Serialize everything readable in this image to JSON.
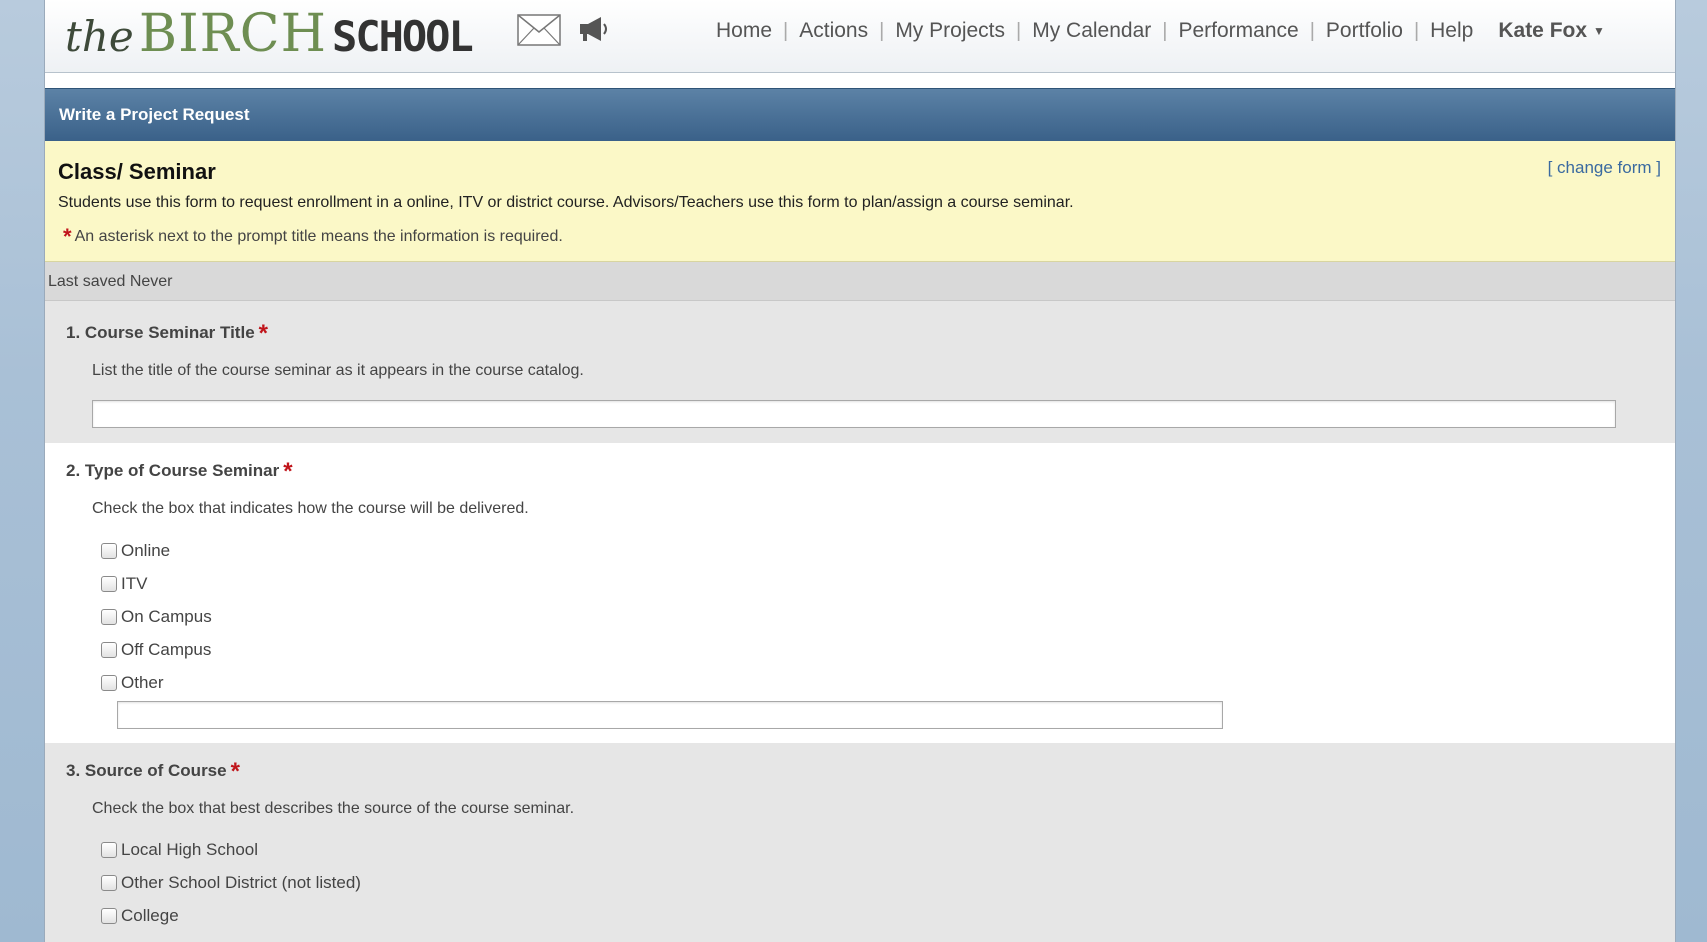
{
  "header": {
    "logo": {
      "the": "the",
      "birch": "BIRCH",
      "school": "SCHOOL"
    },
    "icons": [
      "mail-icon",
      "megaphone-icon"
    ],
    "nav": [
      "Home",
      "Actions",
      "My Projects",
      "My Calendar",
      "Performance",
      "Portfolio",
      "Help"
    ],
    "user": "Kate Fox"
  },
  "titlebar": {
    "title": "Write a Project Request"
  },
  "form": {
    "name": "Class/ Seminar",
    "change_link": "[ change form ]",
    "description": "Students use this form to request enrollment in a online, ITV or district course. Advisors/Teachers use this form to plan/assign a course seminar.",
    "required_note": "An asterisk next to the prompt title means the information is required."
  },
  "last_saved": "Last saved  Never",
  "questions": [
    {
      "title": "1.  Course Seminar Title",
      "help": "List the title of the course seminar as it appears in the course catalog.",
      "value": ""
    },
    {
      "title": "2.  Type of Course Seminar",
      "help": "Check the box that indicates how the course will be delivered.",
      "options": [
        "Online",
        "ITV",
        "On Campus",
        "Off Campus",
        "Other"
      ],
      "other_value": ""
    },
    {
      "title": "3.  Source of Course",
      "help": "Check the box that best describes the source of the course seminar.",
      "options": [
        "Local High School",
        "Other School District (not listed)",
        "College"
      ]
    }
  ],
  "colors": {
    "titlebar": "#3a6189",
    "intro_bg": "#fbf8c7",
    "required_star": "#c0151b",
    "link": "#3a6aa0"
  }
}
